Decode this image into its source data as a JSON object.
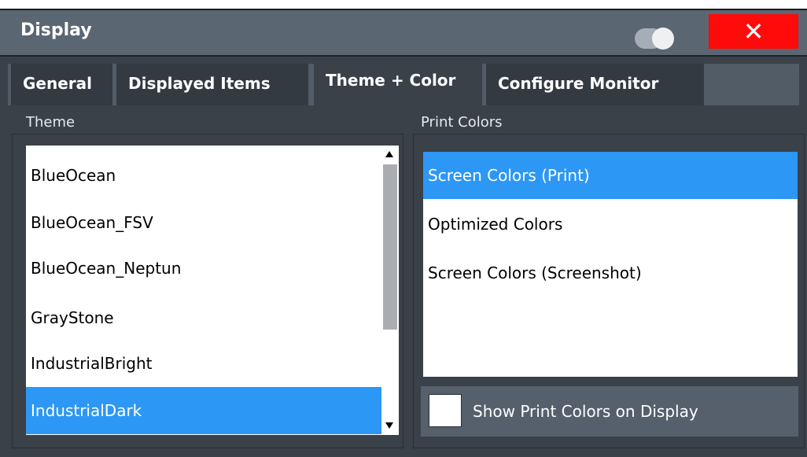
{
  "window": {
    "title": "Display",
    "close_symbol": "✕",
    "toggle_icon": "toggle-switch-icon"
  },
  "tabs": [
    {
      "label": "General",
      "active": false
    },
    {
      "label": "Displayed Items",
      "active": false
    },
    {
      "label": "Theme + Color",
      "active": true
    },
    {
      "label": "Configure Monitor",
      "active": false
    }
  ],
  "theme": {
    "label": "Theme",
    "items": [
      "BlueOcean",
      "BlueOcean_FSV",
      "BlueOcean_Neptun",
      "GrayStone",
      "IndustrialBright",
      "IndustrialDark"
    ],
    "selected": "IndustrialDark"
  },
  "print_colors": {
    "label": "Print Colors",
    "items": [
      "Screen Colors (Print)",
      "Optimized Colors",
      "Screen Colors (Screenshot)"
    ],
    "selected": "Screen Colors (Print)"
  },
  "show_print_colors": {
    "label": "Show Print Colors on Display",
    "checked": false
  },
  "colors": {
    "selection": "#2c97f5",
    "close_button": "#ff0b0b",
    "title_bar": "#5b6673"
  }
}
